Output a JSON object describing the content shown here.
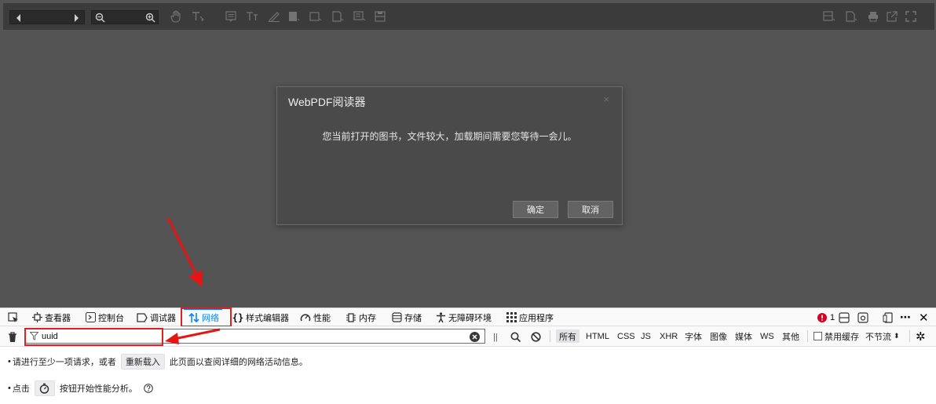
{
  "viewer": {
    "colors": {
      "background": "#545454",
      "toolbar": "#3b3b3b",
      "dialog": "#4a4a4a"
    },
    "toolbar_icons": [
      "prev-page-icon",
      "next-page-icon",
      "zoom-out-icon",
      "zoom-in-icon",
      "hand-tool-icon",
      "select-text-icon",
      "comment-icon",
      "text-icon",
      "pen-icon",
      "highlight-icon",
      "rectangle-icon",
      "stamp-icon",
      "note-icon",
      "save-icon",
      "print-preview-icon",
      "page-view-icon",
      "print-icon",
      "open-external-icon",
      "fullscreen-icon"
    ]
  },
  "dialog": {
    "title": "WebPDF阅读器",
    "close": "×",
    "message": "您当前打开的图书，文件较大，加载期间需要您等待一会儿。",
    "ok": "确定",
    "cancel": "取消"
  },
  "devtools": {
    "tabs": [
      {
        "label": "查看器",
        "icon": "inspector-icon"
      },
      {
        "label": "控制台",
        "icon": "console-icon"
      },
      {
        "label": "调试器",
        "icon": "debugger-icon"
      },
      {
        "label": "网络",
        "icon": "network-icon",
        "active": true
      },
      {
        "label": "样式编辑器",
        "icon": "style-editor-icon"
      },
      {
        "label": "性能",
        "icon": "performance-icon"
      },
      {
        "label": "内存",
        "icon": "memory-icon"
      },
      {
        "label": "存储",
        "icon": "storage-icon"
      },
      {
        "label": "无障碍环境",
        "icon": "accessibility-icon"
      },
      {
        "label": "应用程序",
        "icon": "application-icon"
      }
    ],
    "error_count": "1",
    "accent": "#0a84ff"
  },
  "filter": {
    "value": "uuid",
    "types": [
      "所有",
      "HTML",
      "CSS",
      "JS",
      "XHR",
      "字体",
      "图像",
      "媒体",
      "WS",
      "其他"
    ],
    "disable_cache": "禁用缓存",
    "throttle": "不节流",
    "throttle_arrow": "⬍"
  },
  "panel": {
    "line1_prefix": "请进行至少一项请求，或者",
    "reload": "重新载入",
    "line1_suffix": "此页面以查阅详细的网络活动信息。",
    "line2_prefix": "点击",
    "line2_suffix": "按钮开始性能分析。"
  }
}
